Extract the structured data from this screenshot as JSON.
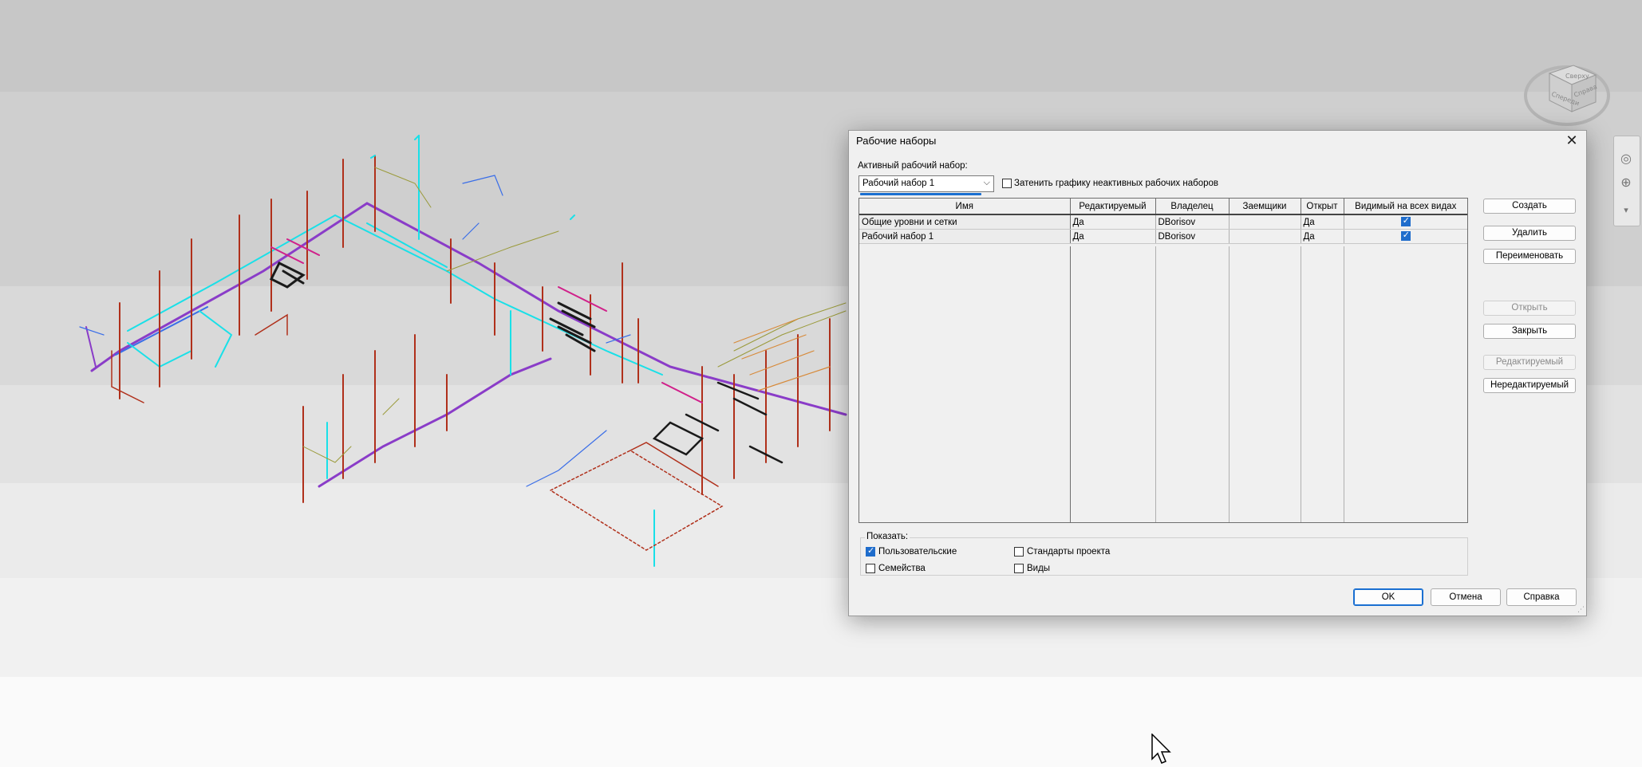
{
  "dialog": {
    "title": "Рабочие наборы",
    "close_icon": "close-icon",
    "active_label": "Активный рабочий набор:",
    "active_value": "Рабочий набор 1",
    "shade_label": "Затенить графику неактивных рабочих наборов",
    "shade_checked": false,
    "columns": [
      "Имя",
      "Редактируемый",
      "Владелец",
      "Заемщики",
      "Открыт",
      "Видимый на всех видах"
    ],
    "rows": [
      {
        "name": "Общие уровни и сетки",
        "editable": "Да",
        "owner": "DBorisov",
        "borrowers": "",
        "open": "Да",
        "visible": true
      },
      {
        "name": "Рабочий набор 1",
        "editable": "Да",
        "owner": "DBorisov",
        "borrowers": "",
        "open": "Да",
        "visible": true
      }
    ],
    "buttons": {
      "create": "Создать",
      "delete": "Удалить",
      "rename": "Переименовать",
      "open": "Открыть",
      "close": "Закрыть",
      "editable": "Редактируемый",
      "noneditable": "Нередактируемый"
    },
    "show": {
      "title": "Показать:",
      "user": "Пользовательские",
      "user_checked": true,
      "families": "Семейства",
      "families_checked": false,
      "standards": "Стандарты проекта",
      "standards_checked": false,
      "views": "Виды",
      "views_checked": false
    },
    "footer": {
      "ok": "OK",
      "cancel": "Отмена",
      "help": "Справка"
    }
  },
  "viewcube": {
    "top": "Сверху",
    "front": "Спереди",
    "right": "Справа"
  },
  "colors": {
    "accent": "#1a6fd1",
    "pipe_red": "#b0301b",
    "pipe_cyan": "#19e0e8",
    "pipe_purple": "#8a3cc8",
    "pipe_blue": "#3a6ee8",
    "pipe_olive": "#9a9a3a"
  }
}
